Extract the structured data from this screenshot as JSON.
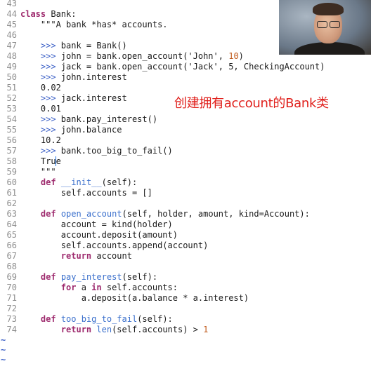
{
  "editor": {
    "lines": [
      {
        "n": "43",
        "tokens": []
      },
      {
        "n": "44",
        "tokens": [
          [
            "kw",
            "class"
          ],
          [
            "t",
            " Bank:"
          ]
        ]
      },
      {
        "n": "45",
        "tokens": [
          [
            "doc",
            "    \"\"\"A bank *has* accounts."
          ]
        ]
      },
      {
        "n": "46",
        "tokens": []
      },
      {
        "n": "47",
        "tokens": [
          [
            "prompt",
            "    >>> "
          ],
          [
            "t",
            "bank = Bank()"
          ]
        ]
      },
      {
        "n": "48",
        "tokens": [
          [
            "prompt",
            "    >>> "
          ],
          [
            "t",
            "john = bank.open_account('John', "
          ],
          [
            "num",
            "10"
          ],
          [
            "t",
            ")"
          ]
        ]
      },
      {
        "n": "49",
        "tokens": [
          [
            "prompt",
            "    >>> "
          ],
          [
            "t",
            "jack = bank.open_account('Jack', 5, CheckingAccount)"
          ]
        ]
      },
      {
        "n": "50",
        "tokens": [
          [
            "prompt",
            "    >>> "
          ],
          [
            "t",
            "john.interest"
          ]
        ]
      },
      {
        "n": "51",
        "tokens": [
          [
            "t",
            "    0.02"
          ]
        ]
      },
      {
        "n": "52",
        "tokens": [
          [
            "prompt",
            "    >>> "
          ],
          [
            "t",
            "jack.interest"
          ]
        ]
      },
      {
        "n": "53",
        "tokens": [
          [
            "t",
            "    0.01"
          ]
        ]
      },
      {
        "n": "54",
        "tokens": [
          [
            "prompt",
            "    >>> "
          ],
          [
            "t",
            "bank.pay_interest()"
          ]
        ]
      },
      {
        "n": "55",
        "tokens": [
          [
            "prompt",
            "    >>> "
          ],
          [
            "t",
            "john.balance"
          ]
        ]
      },
      {
        "n": "56",
        "tokens": [
          [
            "t",
            "    10.2"
          ]
        ]
      },
      {
        "n": "57",
        "tokens": [
          [
            "prompt",
            "    >>> "
          ],
          [
            "t",
            "bank.too_big_to_fail()"
          ]
        ]
      },
      {
        "n": "58",
        "tokens": [
          [
            "t",
            "    Tru"
          ],
          [
            "cursor",
            "e"
          ]
        ]
      },
      {
        "n": "59",
        "tokens": [
          [
            "doc",
            "    \"\"\""
          ]
        ]
      },
      {
        "n": "60",
        "tokens": [
          [
            "t",
            "    "
          ],
          [
            "kw",
            "def"
          ],
          [
            "t",
            " "
          ],
          [
            "func",
            "__init__"
          ],
          [
            "t",
            "(self):"
          ]
        ]
      },
      {
        "n": "61",
        "tokens": [
          [
            "t",
            "        self.accounts = []"
          ]
        ]
      },
      {
        "n": "62",
        "tokens": []
      },
      {
        "n": "63",
        "tokens": [
          [
            "t",
            "    "
          ],
          [
            "kw",
            "def"
          ],
          [
            "t",
            " "
          ],
          [
            "func",
            "open_account"
          ],
          [
            "t",
            "(self, holder, amount, kind=Account):"
          ]
        ]
      },
      {
        "n": "64",
        "tokens": [
          [
            "t",
            "        account = kind(holder)"
          ]
        ]
      },
      {
        "n": "65",
        "tokens": [
          [
            "t",
            "        account.deposit(amount)"
          ]
        ]
      },
      {
        "n": "66",
        "tokens": [
          [
            "t",
            "        self.accounts.append(account)"
          ]
        ]
      },
      {
        "n": "67",
        "tokens": [
          [
            "t",
            "        "
          ],
          [
            "kw",
            "return"
          ],
          [
            "t",
            " account"
          ]
        ]
      },
      {
        "n": "68",
        "tokens": []
      },
      {
        "n": "69",
        "tokens": [
          [
            "t",
            "    "
          ],
          [
            "kw",
            "def"
          ],
          [
            "t",
            " "
          ],
          [
            "func",
            "pay_interest"
          ],
          [
            "t",
            "(self):"
          ]
        ]
      },
      {
        "n": "70",
        "tokens": [
          [
            "t",
            "        "
          ],
          [
            "kw",
            "for"
          ],
          [
            "t",
            " a "
          ],
          [
            "kw",
            "in"
          ],
          [
            "t",
            " self.accounts:"
          ]
        ]
      },
      {
        "n": "71",
        "tokens": [
          [
            "t",
            "            a.deposit(a.balance * a.interest)"
          ]
        ]
      },
      {
        "n": "72",
        "tokens": []
      },
      {
        "n": "73",
        "tokens": [
          [
            "t",
            "    "
          ],
          [
            "kw",
            "def"
          ],
          [
            "t",
            " "
          ],
          [
            "func",
            "too_big_to_fail"
          ],
          [
            "t",
            "(self):"
          ]
        ]
      },
      {
        "n": "74",
        "tokens": [
          [
            "t",
            "        "
          ],
          [
            "kw",
            "return"
          ],
          [
            "t",
            " "
          ],
          [
            "builtin",
            "len"
          ],
          [
            "t",
            "(self.accounts) > "
          ],
          [
            "num",
            "1"
          ]
        ]
      }
    ],
    "tildes": [
      "~",
      "~",
      "~"
    ]
  },
  "caption": "创建拥有account的Bank类",
  "colors": {
    "keyword": "#9e2b6e",
    "prompt": "#3a5fc6",
    "function": "#3a6fcc",
    "number": "#c05a1b",
    "caption": "#e0201c",
    "line_number": "#8e8e8e"
  }
}
